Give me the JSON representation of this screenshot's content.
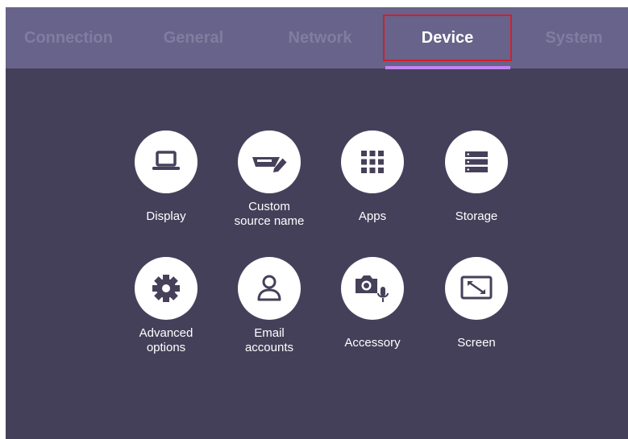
{
  "tabs": [
    {
      "label": "Connection",
      "active": false
    },
    {
      "label": "General",
      "active": false
    },
    {
      "label": "Network",
      "active": false
    },
    {
      "label": "Device",
      "active": true
    },
    {
      "label": "System",
      "active": false
    }
  ],
  "items": [
    {
      "label": "Display",
      "icon": "laptop-icon"
    },
    {
      "label": "Custom\nsource name",
      "icon": "input-pen-icon"
    },
    {
      "label": "Apps",
      "icon": "apps-grid-icon"
    },
    {
      "label": "Storage",
      "icon": "storage-icon"
    },
    {
      "label": "Advanced\noptions",
      "icon": "gear-icon"
    },
    {
      "label": "Email\naccounts",
      "icon": "person-icon"
    },
    {
      "label": "Accessory",
      "icon": "camera-mic-icon"
    },
    {
      "label": "Screen",
      "icon": "screen-resize-icon"
    }
  ],
  "colors": {
    "background": "#45405a",
    "tabbar": "#67638a",
    "tab_inactive": "#807da0",
    "tab_active": "#ffffff",
    "highlight_box": "#d0202e",
    "underline": "#c084f0",
    "icon": "#46405a"
  }
}
